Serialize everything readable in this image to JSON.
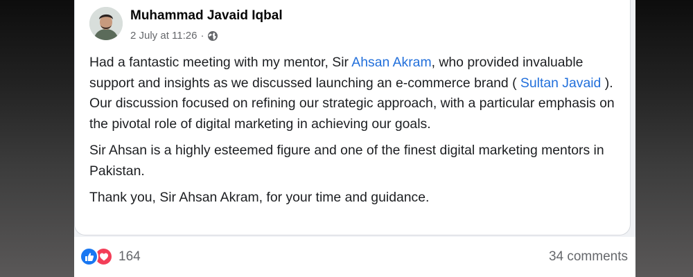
{
  "post": {
    "author": "Muhammad Javaid Iqbal",
    "timestamp": "2 July at 11:26",
    "separator": "·",
    "audience_icon": "globe-icon",
    "paragraph1": {
      "part1": "Had a fantastic meeting with my mentor, Sir ",
      "mention1": "Ahsan Akram",
      "part2": ", who provided invaluable support and insights as we discussed launching an e-commerce brand ( ",
      "mention2": "Sultan Javaid",
      "part3": " ). Our discussion focused on refining our strategic approach, with a particular emphasis on the pivotal role of digital marketing in achieving our goals."
    },
    "paragraph2": "Sir Ahsan is a highly esteemed figure and one of the finest digital marketing mentors in Pakistan.",
    "paragraph3": "Thank you, Sir Ahsan Akram, for your time and guidance."
  },
  "footer": {
    "reaction_icons": [
      "like-icon",
      "love-icon"
    ],
    "reaction_count": "164",
    "comments": "34 comments"
  },
  "colors": {
    "mention": "#216fdb",
    "like": "#1877f2",
    "love": "#f33e58",
    "muted_text": "#65676b"
  }
}
